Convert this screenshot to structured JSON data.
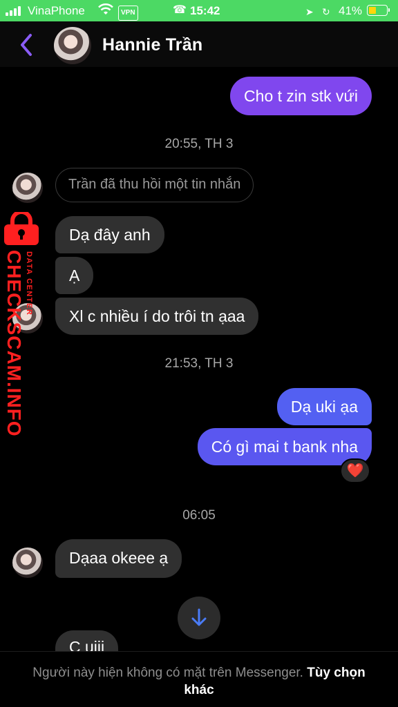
{
  "status_bar": {
    "carrier": "VinaPhone",
    "vpn": "VPN",
    "time": "15:42",
    "battery": "41%",
    "battery_level": 0.41,
    "background_color": "#4cd964"
  },
  "header": {
    "contact_name": "Hannie Trần",
    "back_icon": "chevron-left-icon",
    "accent_color": "#8a5cf6"
  },
  "messages": {
    "out_1": "Cho t zin stk vứi",
    "ts_1": "20:55, TH 3",
    "unsent_notice": "Trần đã thu hồi một tin nhắn",
    "in_1": "Dạ đây anh",
    "in_2": "Ạ",
    "in_3": "Xl c nhiều í do trôi tn ạaa",
    "ts_2": "21:53, TH 3",
    "out_2": "Dạ uki ạa",
    "out_3": "Có gì mai t bank nha",
    "reaction": "❤️",
    "ts_3": "06:05",
    "in_4": "Dạaa okeee ạ",
    "in_5": "C uiii"
  },
  "watermark": {
    "site": "CHECKSCAM.INFO",
    "subtitle": "DATA CENTER"
  },
  "footer": {
    "notice": "Người này hiện không có mặt trên Messenger.",
    "options_link": "Tùy chọn khác"
  }
}
